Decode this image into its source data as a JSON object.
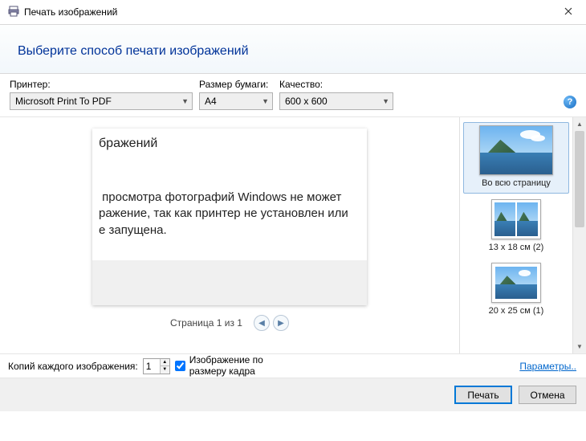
{
  "window": {
    "title": "Печать изображений"
  },
  "header": {
    "subtitle": "Выберите способ печати изображений"
  },
  "settings": {
    "printer_label": "Принтер:",
    "printer_value": "Microsoft Print To PDF",
    "paper_label": "Размер бумаги:",
    "paper_value": "A4",
    "quality_label": "Качество:",
    "quality_value": "600 x 600"
  },
  "preview": {
    "text_title": "бражений",
    "text_body": " просмотра фотографий Windows не может\nражение, так как принтер не установлен или\nе запущена.",
    "page_indicator": "Страница 1 из 1"
  },
  "layouts": [
    {
      "label": "Во всю страницу",
      "selected": true
    },
    {
      "label": "13 x 18 см (2)",
      "selected": false
    },
    {
      "label": "20 x 25 см (1)",
      "selected": false
    }
  ],
  "lower": {
    "copies_label": "Копий каждого изображения:",
    "copies_value": "1",
    "fit_checked": true,
    "fit_label": "Изображение по размеру кадра",
    "params_link": "Параметры.."
  },
  "buttons": {
    "print": "Печать",
    "cancel": "Отмена"
  }
}
